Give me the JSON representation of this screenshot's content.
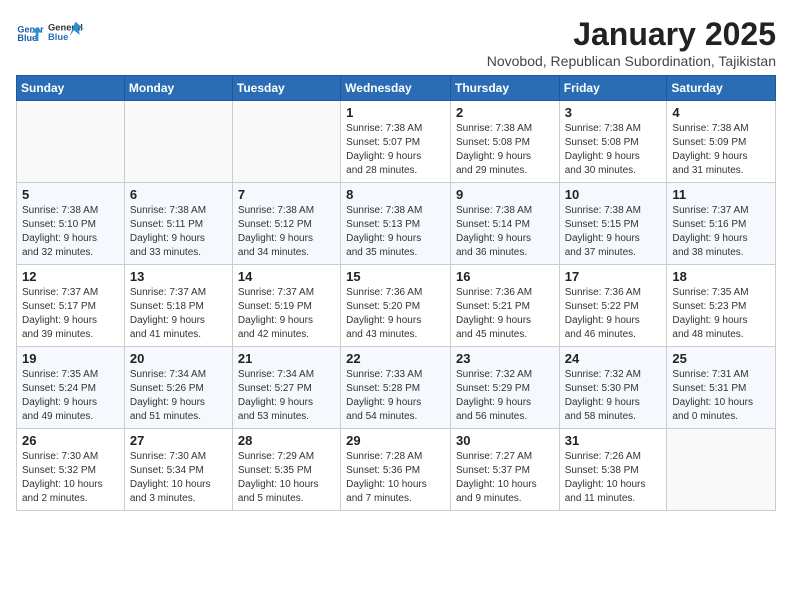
{
  "logo": {
    "line1": "General",
    "line2": "Blue"
  },
  "title": "January 2025",
  "subtitle": "Novobod, Republican Subordination, Tajikistan",
  "weekdays": [
    "Sunday",
    "Monday",
    "Tuesday",
    "Wednesday",
    "Thursday",
    "Friday",
    "Saturday"
  ],
  "weeks": [
    [
      {
        "day": "",
        "info": ""
      },
      {
        "day": "",
        "info": ""
      },
      {
        "day": "",
        "info": ""
      },
      {
        "day": "1",
        "info": "Sunrise: 7:38 AM\nSunset: 5:07 PM\nDaylight: 9 hours\nand 28 minutes."
      },
      {
        "day": "2",
        "info": "Sunrise: 7:38 AM\nSunset: 5:08 PM\nDaylight: 9 hours\nand 29 minutes."
      },
      {
        "day": "3",
        "info": "Sunrise: 7:38 AM\nSunset: 5:08 PM\nDaylight: 9 hours\nand 30 minutes."
      },
      {
        "day": "4",
        "info": "Sunrise: 7:38 AM\nSunset: 5:09 PM\nDaylight: 9 hours\nand 31 minutes."
      }
    ],
    [
      {
        "day": "5",
        "info": "Sunrise: 7:38 AM\nSunset: 5:10 PM\nDaylight: 9 hours\nand 32 minutes."
      },
      {
        "day": "6",
        "info": "Sunrise: 7:38 AM\nSunset: 5:11 PM\nDaylight: 9 hours\nand 33 minutes."
      },
      {
        "day": "7",
        "info": "Sunrise: 7:38 AM\nSunset: 5:12 PM\nDaylight: 9 hours\nand 34 minutes."
      },
      {
        "day": "8",
        "info": "Sunrise: 7:38 AM\nSunset: 5:13 PM\nDaylight: 9 hours\nand 35 minutes."
      },
      {
        "day": "9",
        "info": "Sunrise: 7:38 AM\nSunset: 5:14 PM\nDaylight: 9 hours\nand 36 minutes."
      },
      {
        "day": "10",
        "info": "Sunrise: 7:38 AM\nSunset: 5:15 PM\nDaylight: 9 hours\nand 37 minutes."
      },
      {
        "day": "11",
        "info": "Sunrise: 7:37 AM\nSunset: 5:16 PM\nDaylight: 9 hours\nand 38 minutes."
      }
    ],
    [
      {
        "day": "12",
        "info": "Sunrise: 7:37 AM\nSunset: 5:17 PM\nDaylight: 9 hours\nand 39 minutes."
      },
      {
        "day": "13",
        "info": "Sunrise: 7:37 AM\nSunset: 5:18 PM\nDaylight: 9 hours\nand 41 minutes."
      },
      {
        "day": "14",
        "info": "Sunrise: 7:37 AM\nSunset: 5:19 PM\nDaylight: 9 hours\nand 42 minutes."
      },
      {
        "day": "15",
        "info": "Sunrise: 7:36 AM\nSunset: 5:20 PM\nDaylight: 9 hours\nand 43 minutes."
      },
      {
        "day": "16",
        "info": "Sunrise: 7:36 AM\nSunset: 5:21 PM\nDaylight: 9 hours\nand 45 minutes."
      },
      {
        "day": "17",
        "info": "Sunrise: 7:36 AM\nSunset: 5:22 PM\nDaylight: 9 hours\nand 46 minutes."
      },
      {
        "day": "18",
        "info": "Sunrise: 7:35 AM\nSunset: 5:23 PM\nDaylight: 9 hours\nand 48 minutes."
      }
    ],
    [
      {
        "day": "19",
        "info": "Sunrise: 7:35 AM\nSunset: 5:24 PM\nDaylight: 9 hours\nand 49 minutes."
      },
      {
        "day": "20",
        "info": "Sunrise: 7:34 AM\nSunset: 5:26 PM\nDaylight: 9 hours\nand 51 minutes."
      },
      {
        "day": "21",
        "info": "Sunrise: 7:34 AM\nSunset: 5:27 PM\nDaylight: 9 hours\nand 53 minutes."
      },
      {
        "day": "22",
        "info": "Sunrise: 7:33 AM\nSunset: 5:28 PM\nDaylight: 9 hours\nand 54 minutes."
      },
      {
        "day": "23",
        "info": "Sunrise: 7:32 AM\nSunset: 5:29 PM\nDaylight: 9 hours\nand 56 minutes."
      },
      {
        "day": "24",
        "info": "Sunrise: 7:32 AM\nSunset: 5:30 PM\nDaylight: 9 hours\nand 58 minutes."
      },
      {
        "day": "25",
        "info": "Sunrise: 7:31 AM\nSunset: 5:31 PM\nDaylight: 10 hours\nand 0 minutes."
      }
    ],
    [
      {
        "day": "26",
        "info": "Sunrise: 7:30 AM\nSunset: 5:32 PM\nDaylight: 10 hours\nand 2 minutes."
      },
      {
        "day": "27",
        "info": "Sunrise: 7:30 AM\nSunset: 5:34 PM\nDaylight: 10 hours\nand 3 minutes."
      },
      {
        "day": "28",
        "info": "Sunrise: 7:29 AM\nSunset: 5:35 PM\nDaylight: 10 hours\nand 5 minutes."
      },
      {
        "day": "29",
        "info": "Sunrise: 7:28 AM\nSunset: 5:36 PM\nDaylight: 10 hours\nand 7 minutes."
      },
      {
        "day": "30",
        "info": "Sunrise: 7:27 AM\nSunset: 5:37 PM\nDaylight: 10 hours\nand 9 minutes."
      },
      {
        "day": "31",
        "info": "Sunrise: 7:26 AM\nSunset: 5:38 PM\nDaylight: 10 hours\nand 11 minutes."
      },
      {
        "day": "",
        "info": ""
      }
    ]
  ]
}
